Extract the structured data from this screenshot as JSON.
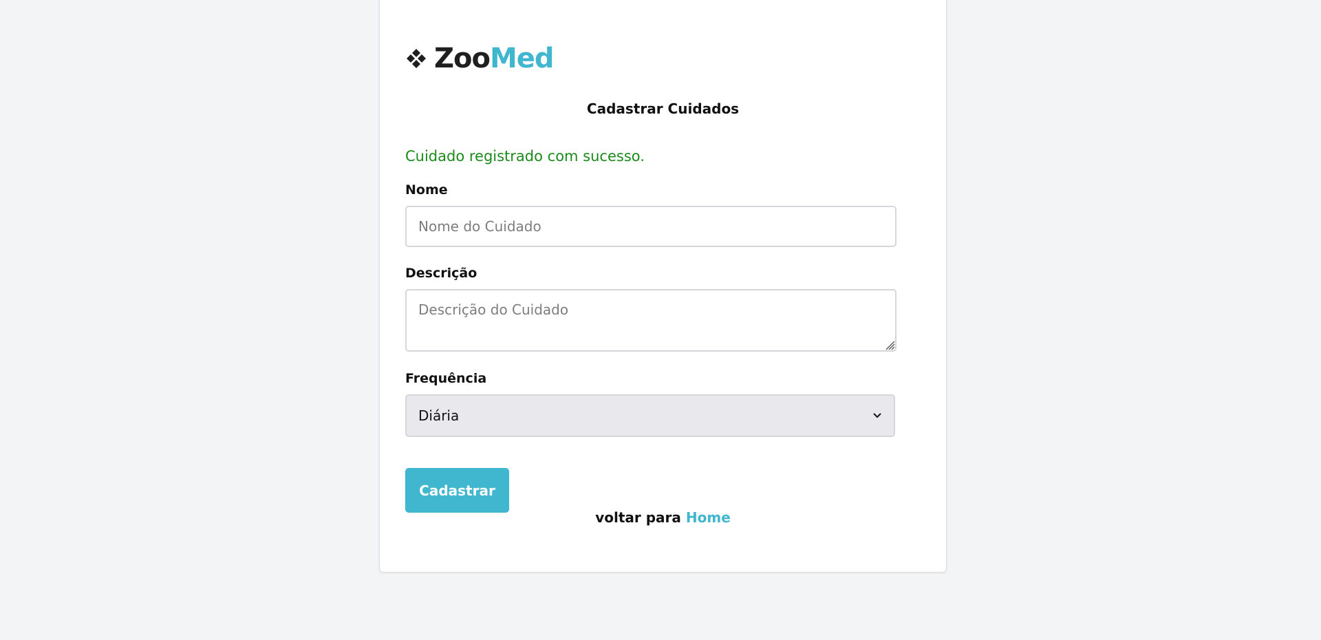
{
  "brand": {
    "name_part1": "Zoo",
    "name_part2": "Med",
    "icon": "diamond-cluster-icon",
    "colors": {
      "dark": "#1f1f1f",
      "accent": "#41b6cf"
    }
  },
  "form": {
    "title": "Cadastrar Cuidados",
    "success_message": "Cuidado registrado com sucesso.",
    "success_color": "#1a8a1a",
    "name_label": "Nome",
    "name_placeholder": "Nome do Cuidado",
    "name_value": "",
    "description_label": "Descrição",
    "description_placeholder": "Descrição do Cuidado",
    "description_value": "",
    "frequency_label": "Frequência",
    "frequency_selected": "Diária",
    "submit_label": "Cadastrar"
  },
  "footer": {
    "back_text": "voltar para",
    "home_link": "Home"
  }
}
